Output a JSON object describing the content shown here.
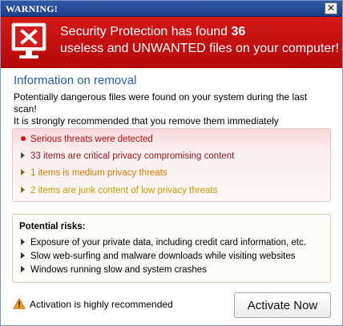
{
  "window": {
    "title": "WARNING!",
    "close_glyph": "✕"
  },
  "banner": {
    "line1_prefix": "Security Protection has found ",
    "count": "36",
    "line2": "useless and UNWANTED files on your computer!",
    "icon": "monitor-x-icon",
    "color": "#c81010"
  },
  "section": {
    "title": "Information on removal",
    "intro1": "Potentially dangerous files were found on your system during the last scan!",
    "intro2": "It is strongly recommended that you remove them immediately"
  },
  "threats": [
    {
      "text": "Serious threats were detected",
      "marker": "dot",
      "color": "#b51010"
    },
    {
      "text": "33 items are critical privacy compromising content",
      "marker": "triangle",
      "color": "#8a1c1c"
    },
    {
      "text": "1 items is medium privacy threats",
      "marker": "triangle",
      "color": "#d07a00"
    },
    {
      "text": "2 items are junk content of low privacy threats",
      "marker": "triangle",
      "color": "#c89a00"
    }
  ],
  "risks": {
    "title": "Potential risks:",
    "items": [
      "Exposure of your private data, including credit card information, etc.",
      "Slow web-surfing and malware downloads while visiting websites",
      "Windows running slow and system crashes"
    ]
  },
  "footer": {
    "warning_text": "Activation is highly recommended",
    "warning_icon": "warning-triangle-icon",
    "button_label": "Activate Now"
  }
}
